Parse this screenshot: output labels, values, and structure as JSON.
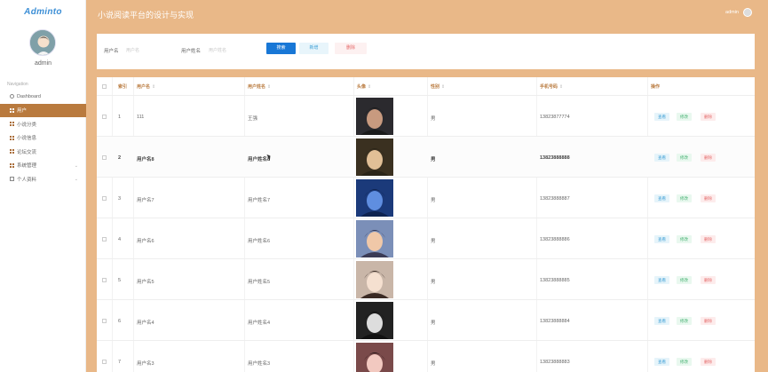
{
  "app": {
    "brand": "Adminto",
    "title": "小说阅读平台的设计与实现",
    "header_user": "admin"
  },
  "sidebar": {
    "username": "admin",
    "section_title": "Navigation",
    "items": [
      {
        "label": "Dashboard",
        "icon": "dashboard-icon"
      },
      {
        "label": "用户",
        "icon": "grid-icon",
        "active": true
      },
      {
        "label": "小说分类",
        "icon": "grid-icon"
      },
      {
        "label": "小说信息",
        "icon": "grid-icon"
      },
      {
        "label": "论坛交流",
        "icon": "grid-icon"
      },
      {
        "label": "系统管理",
        "icon": "grid-icon",
        "has_children": true
      },
      {
        "label": "个人资料",
        "icon": "box-icon",
        "has_children": true
      }
    ]
  },
  "search": {
    "username_label": "用户名",
    "username_placeholder": "用户名",
    "name_label": "用户姓名",
    "name_placeholder": "用户姓名",
    "search_btn": "搜索",
    "add_btn": "新增",
    "delete_btn": "删除"
  },
  "table": {
    "headers": {
      "index": "索引",
      "username": "用户名",
      "name": "用户姓名",
      "avatar": "头像",
      "gender": "性别",
      "phone": "手机号码",
      "actions": "操作"
    },
    "sort_glyph": "⇕",
    "actions": {
      "view": "查看",
      "edit": "修改",
      "delete": "删除"
    },
    "rows": [
      {
        "index": "1",
        "username": "111",
        "name": "王强",
        "gender": "男",
        "phone": "13823877774"
      },
      {
        "index": "2",
        "username": "用户名8",
        "name": "用户姓名8",
        "gender": "男",
        "phone": "13823888888"
      },
      {
        "index": "3",
        "username": "用户名7",
        "name": "用户姓名7",
        "gender": "男",
        "phone": "13823888887"
      },
      {
        "index": "4",
        "username": "用户名6",
        "name": "用户姓名6",
        "gender": "男",
        "phone": "13823888886"
      },
      {
        "index": "5",
        "username": "用户名5",
        "name": "用户姓名5",
        "gender": "男",
        "phone": "13823888885"
      },
      {
        "index": "6",
        "username": "用户名4",
        "name": "用户姓名4",
        "gender": "男",
        "phone": "13823888884"
      },
      {
        "index": "7",
        "username": "用户名3",
        "name": "用户姓名3",
        "gender": "男",
        "phone": "13823888883"
      }
    ]
  },
  "colors": {
    "header_bg": "#e9b888",
    "active_nav": "#b97a3e",
    "primary_button": "#1877d6"
  }
}
